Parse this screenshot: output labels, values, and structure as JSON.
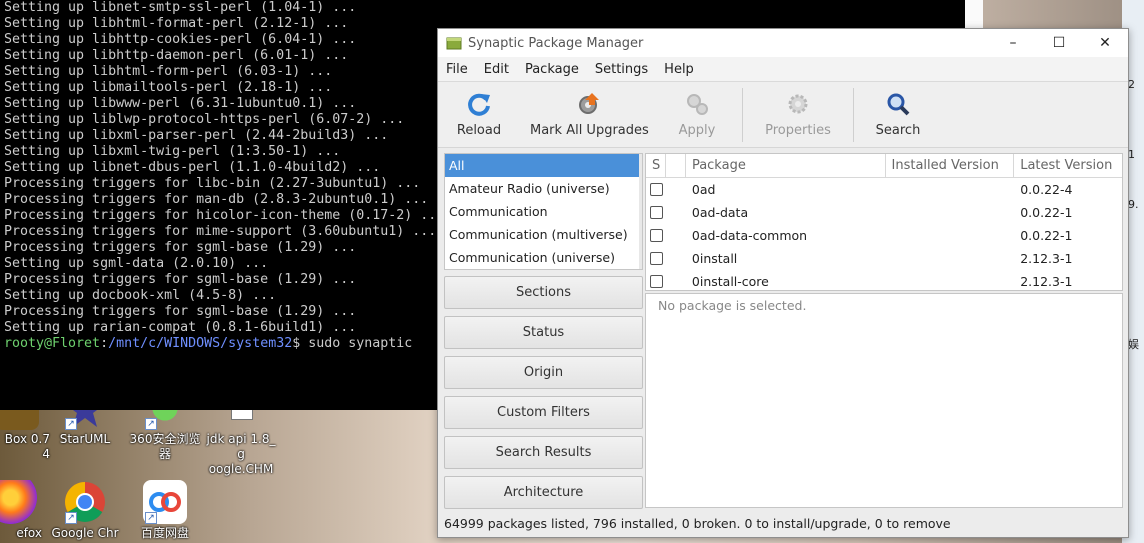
{
  "terminal": {
    "lines": [
      "Setting up libnet-smtp-ssl-perl (1.04-1) ...",
      "Setting up libhtml-format-perl (2.12-1) ...",
      "Setting up libhttp-cookies-perl (6.04-1) ...",
      "Setting up libhttp-daemon-perl (6.01-1) ...",
      "Setting up libhtml-form-perl (6.03-1) ...",
      "Setting up libmailtools-perl (2.18-1) ...",
      "Setting up libwww-perl (6.31-1ubuntu0.1) ...",
      "Setting up liblwp-protocol-https-perl (6.07-2) ...",
      "Setting up libxml-parser-perl (2.44-2build3) ...",
      "Setting up libxml-twig-perl (1:3.50-1) ...",
      "Setting up libnet-dbus-perl (1.1.0-4build2) ...",
      "Processing triggers for libc-bin (2.27-3ubuntu1) ...",
      "Processing triggers for man-db (2.8.3-2ubuntu0.1) ...",
      "Processing triggers for hicolor-icon-theme (0.17-2) ...",
      "Processing triggers for mime-support (3.60ubuntu1) ...",
      "Processing triggers for sgml-base (1.29) ...",
      "Setting up sgml-data (2.0.10) ...",
      "Processing triggers for sgml-base (1.29) ...",
      "Setting up docbook-xml (4.5-8) ...",
      "Processing triggers for sgml-base (1.29) ...",
      "Setting up rarian-compat (0.8.1-6build1) ..."
    ],
    "prompt_user": "rooty@Floret",
    "prompt_sep": ":",
    "prompt_path": "/mnt/c/WINDOWS/system32",
    "prompt_cmd": "$ sudo synaptic"
  },
  "desktop": {
    "icons": [
      {
        "label": "Box 0.7\n4"
      },
      {
        "label": "StarUML"
      },
      {
        "label": "360安全浏览\n器"
      },
      {
        "label": "jdk api 1.8_g\noogle.CHM"
      },
      {
        "label": "efox"
      },
      {
        "label": "Google Chro"
      },
      {
        "label": "百度网盘"
      }
    ],
    "right_frags": [
      "2",
      "1",
      "9.",
      "娱"
    ]
  },
  "window": {
    "title": "Synaptic Package Manager",
    "controls": {
      "minimize": "–",
      "maximize": "☐",
      "close": "✕"
    },
    "menu": [
      "File",
      "Edit",
      "Package",
      "Settings",
      "Help"
    ],
    "toolbar": {
      "reload": "Reload",
      "mark_all": "Mark All Upgrades",
      "apply": "Apply",
      "properties": "Properties",
      "search": "Search"
    },
    "categories": [
      "All",
      "Amateur Radio (universe)",
      "Communication",
      "Communication (multiverse)",
      "Communication (universe)"
    ],
    "filters": [
      "Sections",
      "Status",
      "Origin",
      "Custom Filters",
      "Search Results",
      "Architecture"
    ],
    "columns": {
      "s": "S",
      "package": "Package",
      "installed": "Installed Version",
      "latest": "Latest Version"
    },
    "packages": [
      {
        "name": "0ad",
        "installed": "",
        "latest": "0.0.22-4"
      },
      {
        "name": "0ad-data",
        "installed": "",
        "latest": "0.0.22-1"
      },
      {
        "name": "0ad-data-common",
        "installed": "",
        "latest": "0.0.22-1"
      },
      {
        "name": "0install",
        "installed": "",
        "latest": "2.12.3-1"
      },
      {
        "name": "0install-core",
        "installed": "",
        "latest": "2.12.3-1"
      }
    ],
    "detail_text": "No package is selected.",
    "status": "64999 packages listed, 796 installed, 0 broken. 0 to install/upgrade, 0 to remove",
    "colors": {
      "selection": "#4a90d9",
      "reload_icon": "#2f7fd4",
      "search_icon": "#2a56a6"
    }
  }
}
